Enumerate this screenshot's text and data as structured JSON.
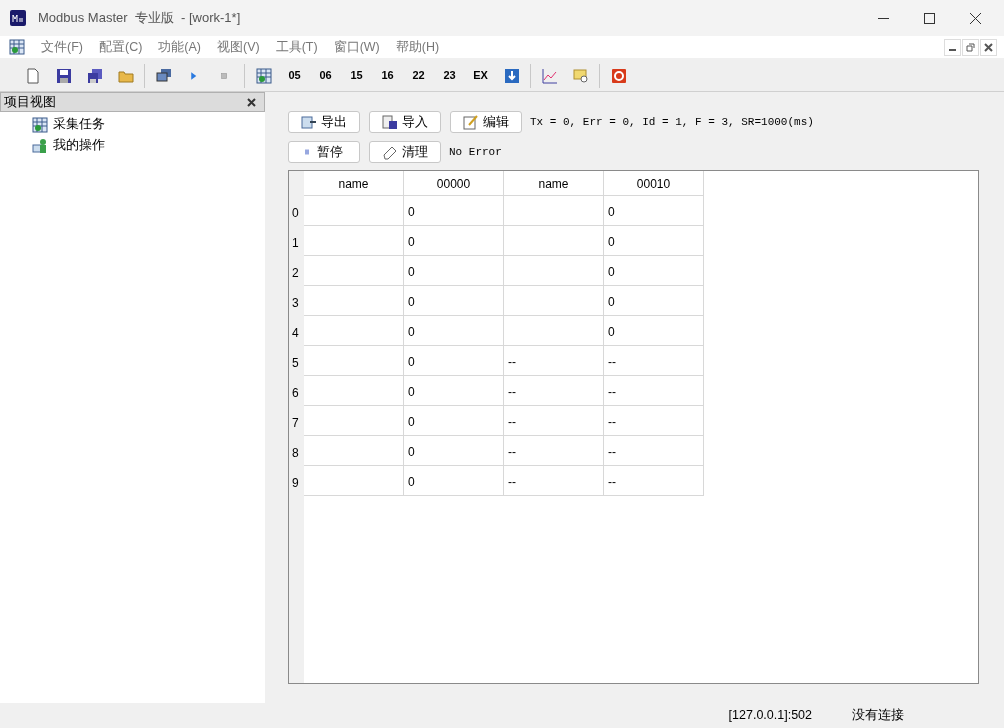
{
  "window": {
    "title": "Modbus Master  专业版  - [work-1*]"
  },
  "menu": [
    "文件(F)",
    "配置(C)",
    "功能(A)",
    "视图(V)",
    "工具(T)",
    "窗口(W)",
    "帮助(H)"
  ],
  "toolbar": {
    "function_codes": [
      "05",
      "06",
      "15",
      "16",
      "22",
      "23",
      "EX"
    ]
  },
  "project_panel": {
    "title": "项目视图",
    "items": [
      "采集任务",
      "我的操作"
    ]
  },
  "actions_row_1": {
    "buttons": [
      "导出",
      "导入",
      "编辑"
    ],
    "status": "Tx = 0, Err = 0, Id = 1, F = 3, SR=1000(ms)"
  },
  "actions_row_2": {
    "buttons": [
      "暂停",
      "清理"
    ],
    "status": "No Error"
  },
  "table": {
    "columns": [
      "name",
      "00000",
      "name",
      "00010"
    ],
    "rows": [
      {
        "header": "0",
        "cells": [
          "",
          "0",
          "",
          "0"
        ]
      },
      {
        "header": "1",
        "cells": [
          "",
          "0",
          "",
          "0"
        ]
      },
      {
        "header": "2",
        "cells": [
          "",
          "0",
          "",
          "0"
        ]
      },
      {
        "header": "3",
        "cells": [
          "",
          "0",
          "",
          "0"
        ]
      },
      {
        "header": "4",
        "cells": [
          "",
          "0",
          "",
          "0"
        ]
      },
      {
        "header": "5",
        "cells": [
          "",
          "0",
          "--",
          "--"
        ]
      },
      {
        "header": "6",
        "cells": [
          "",
          "0",
          "--",
          "--"
        ]
      },
      {
        "header": "7",
        "cells": [
          "",
          "0",
          "--",
          "--"
        ]
      },
      {
        "header": "8",
        "cells": [
          "",
          "0",
          "--",
          "--"
        ]
      },
      {
        "header": "9",
        "cells": [
          "",
          "0",
          "--",
          "--"
        ]
      }
    ]
  },
  "status_bar": {
    "address": "[127.0.0.1]:502",
    "connection": "没有连接"
  }
}
